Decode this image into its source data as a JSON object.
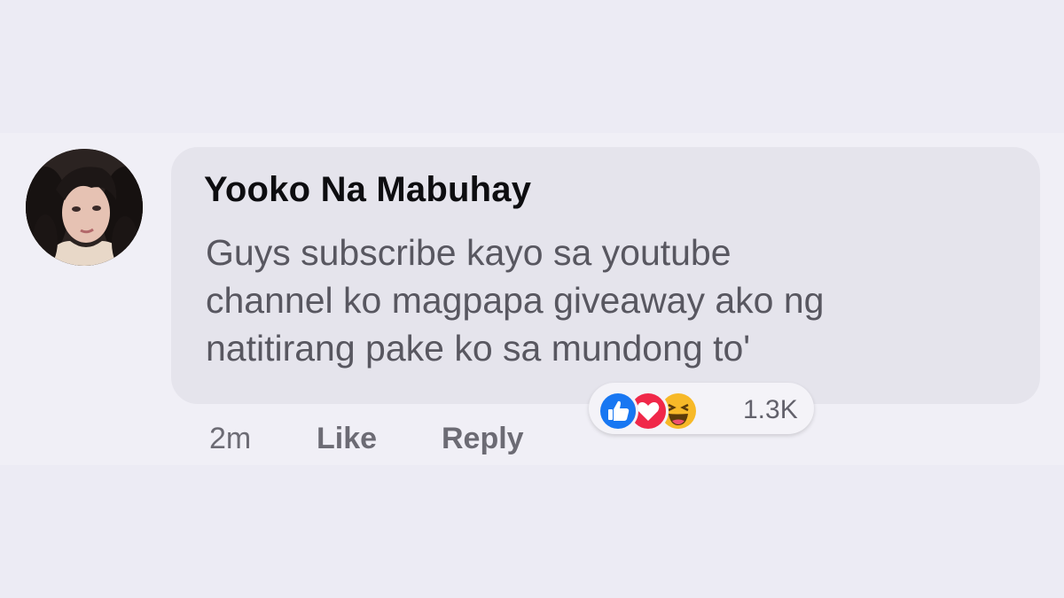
{
  "comment": {
    "author": "Yooko Na Mabuhay",
    "text_lines": [
      "Guys subscribe kayo sa youtube",
      "channel ko magpapa giveaway ako ng",
      "natitirang pake ko sa mundong to'"
    ],
    "timestamp": "2m",
    "like_label": "Like",
    "reply_label": "Reply",
    "reactions": {
      "icons": [
        "like-icon",
        "love-icon",
        "haha-icon"
      ],
      "count": "1.3K"
    }
  },
  "colors": {
    "background": "#ecebf4",
    "bubble": "#e5e4ec",
    "author_text": "#0d0d10",
    "comment_text": "#585760",
    "meta_text": "#6c6b74",
    "like_blue": "#1877f2",
    "love_red": "#f02849",
    "haha_yellow": "#f7b928"
  }
}
